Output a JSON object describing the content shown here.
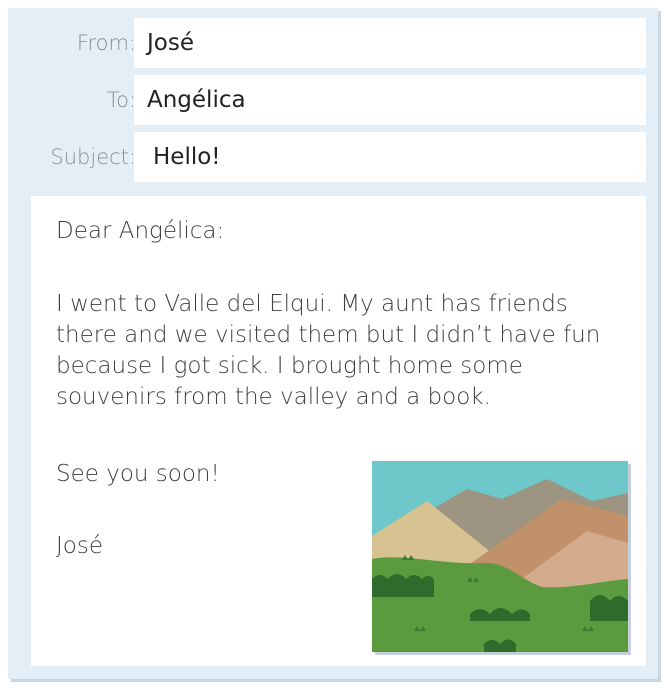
{
  "header": {
    "from_label": "From:",
    "from_value": "José",
    "to_label": "To:",
    "to_value": "Angélica",
    "subject_label": "Subject:",
    "subject_value": "Hello!"
  },
  "letter": {
    "greeting": "Dear Angélica:",
    "message": "I went to Valle del Elqui. My aunt has friends there and we visited them but I didn’t have fun because I got sick. I brought home some souvenirs from the valley and a book.",
    "signoff": "See you soon!",
    "signature": "José"
  },
  "colors": {
    "card": "#e4eef6",
    "sky": "#6ec7c8",
    "grass": "#5b9a3e",
    "bush": "#2f6b2a"
  }
}
